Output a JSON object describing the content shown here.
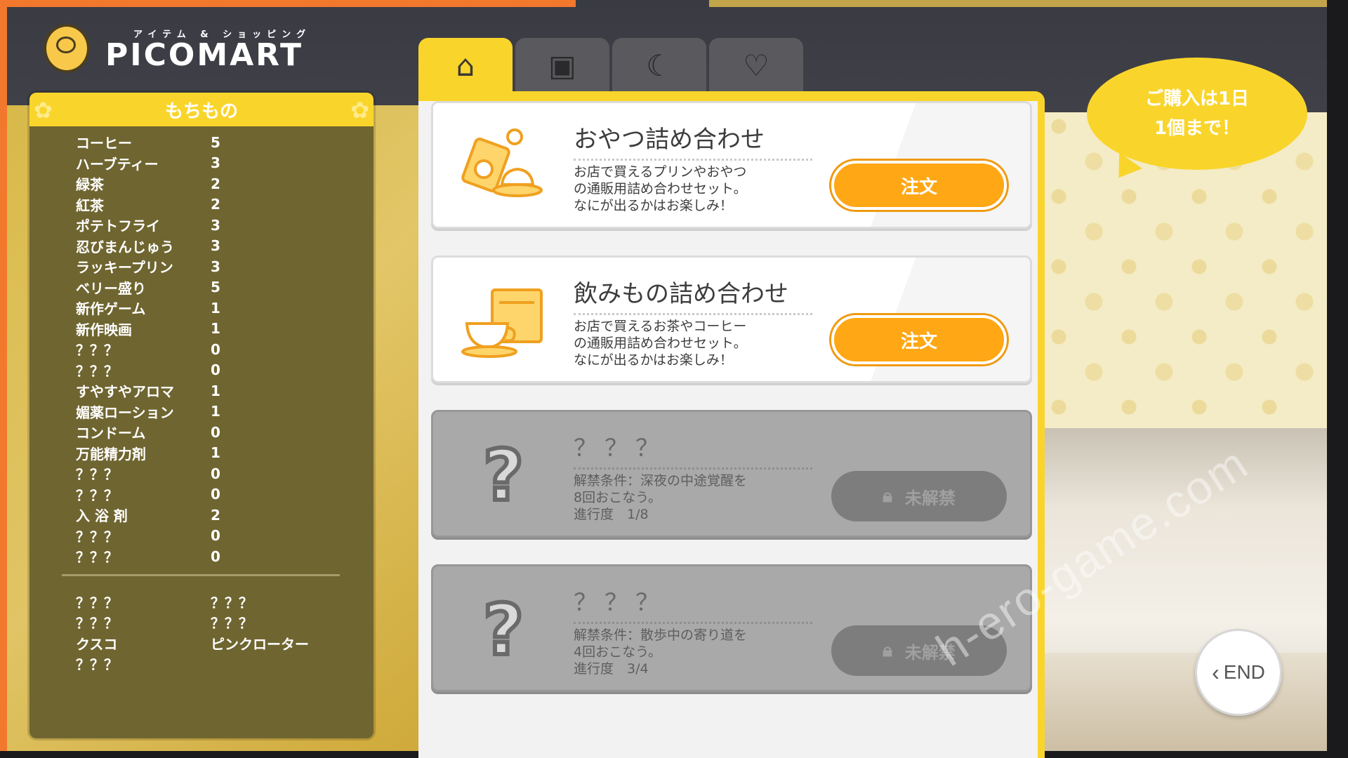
{
  "logo": {
    "subtitle": "アイテム & ショッピング",
    "name": "PICOMART"
  },
  "inventory": {
    "title": "もちもの",
    "items": [
      {
        "name": "コーヒー",
        "qty": "5"
      },
      {
        "name": "ハーブティー",
        "qty": "3"
      },
      {
        "name": "緑茶",
        "qty": "2"
      },
      {
        "name": "紅茶",
        "qty": "2"
      },
      {
        "name": "ポテトフライ",
        "qty": "3"
      },
      {
        "name": "忍びまんじゅう",
        "qty": "3"
      },
      {
        "name": "ラッキープリン",
        "qty": "3"
      },
      {
        "name": "ベリー盛り",
        "qty": "5"
      },
      {
        "name": "新作ゲーム",
        "qty": "1"
      },
      {
        "name": "新作映画",
        "qty": "1"
      },
      {
        "name": "？？？",
        "qty": "0"
      },
      {
        "name": "？？？",
        "qty": "0"
      },
      {
        "name": "すやすやアロマ",
        "qty": "1"
      },
      {
        "name": "媚薬ローション",
        "qty": "1"
      },
      {
        "name": "コンドーム",
        "qty": "0"
      },
      {
        "name": "万能精力剤",
        "qty": "1"
      },
      {
        "name": "？？？",
        "qty": "0"
      },
      {
        "name": "？？？",
        "qty": "0"
      },
      {
        "name": "入 浴 剤",
        "qty": "2"
      },
      {
        "name": "？？？",
        "qty": "0"
      },
      {
        "name": "？？？",
        "qty": "0"
      }
    ],
    "key_items": [
      [
        "？？？",
        "？？？"
      ],
      [
        "？？？",
        "？？？"
      ],
      [
        "クスコ",
        "ピンクローター"
      ],
      [
        "？？？",
        ""
      ]
    ]
  },
  "tabs": [
    {
      "icon": "home-icon",
      "glyph": "⌂"
    },
    {
      "icon": "tv-icon",
      "glyph": "▣"
    },
    {
      "icon": "moon-star-icon",
      "glyph": "☾"
    },
    {
      "icon": "hearts-icon",
      "glyph": "♡"
    }
  ],
  "shop": {
    "cards": [
      {
        "title": "おやつ詰め合わせ",
        "desc": [
          "お店で買えるプリンやおやつ",
          "の通販用詰め合わせセット。",
          "なにが出るかはお楽しみ！"
        ],
        "button": "注文"
      },
      {
        "title": "飲みもの詰め合わせ",
        "desc": [
          "お店で買えるお茶やコーヒー",
          "の通販用詰め合わせセット。",
          "なにが出るかはお楽しみ！"
        ],
        "button": "注文"
      },
      {
        "title": "？？？",
        "desc": [
          "解禁条件：深夜の中途覚醒を",
          "8回おこなう。",
          "進行度　1/8"
        ],
        "button": "未解禁"
      },
      {
        "title": "？？？",
        "desc": [
          "解禁条件：散歩中の寄り道を",
          "4回おこなう。",
          "進行度　3/4"
        ],
        "button": "未解禁"
      }
    ]
  },
  "bubble": {
    "line1": "ご購入は1日",
    "line2": "1個まで！"
  },
  "end_button": {
    "label": "END"
  },
  "watermark": "h-ero-game.com",
  "colors": {
    "accent": "#f9d52c",
    "order": "#ffa714",
    "panel": "#6f6530"
  }
}
